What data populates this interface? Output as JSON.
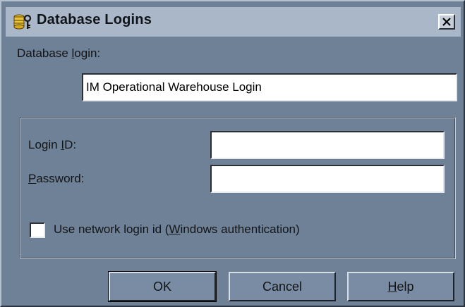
{
  "window": {
    "title": "Database Logins"
  },
  "database_login": {
    "label_pre": "Database ",
    "label_accel": "l",
    "label_post": "ogin:",
    "value": "IM Operational Warehouse Login"
  },
  "login_id": {
    "label_pre": "Login ",
    "label_accel": "I",
    "label_post": "D:",
    "value": ""
  },
  "password": {
    "label_pre": "",
    "label_accel": "P",
    "label_post": "assword:",
    "value": ""
  },
  "network_login": {
    "label_pre": "Use network login id (",
    "label_accel": "W",
    "label_post": "indows authentication)",
    "checked": false
  },
  "buttons": {
    "ok": "OK",
    "cancel": "Cancel",
    "help_accel": "H",
    "help_post": "elp"
  },
  "colors": {
    "dialog_bg": "#6f8196",
    "titlebar_bg": "#a9b7c9",
    "button_bg": "#7a8ca3",
    "field_bg": "#ffffff"
  },
  "icons": {
    "title": "database-key-icon",
    "close": "close-icon"
  }
}
